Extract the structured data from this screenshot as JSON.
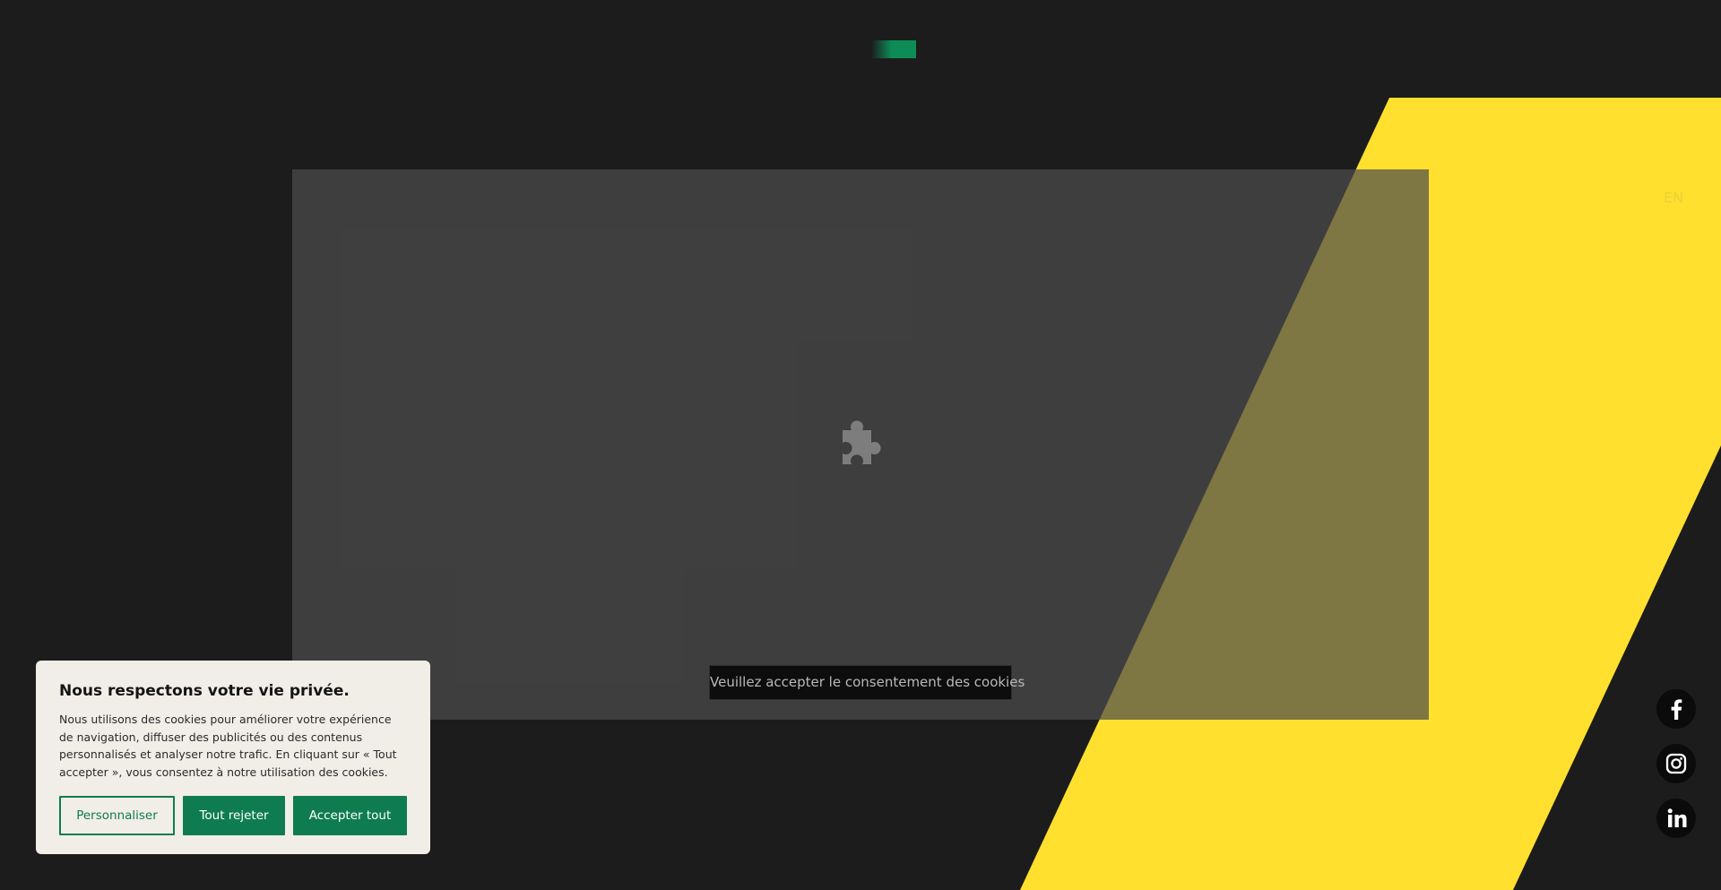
{
  "page": {
    "language_switch": "EN"
  },
  "colors": {
    "background": "#1c1c1c",
    "accent_yellow": "#ffe02e",
    "brand_green": "#0e7c4f",
    "banner_background": "#f1ede7"
  },
  "embed": {
    "icon": "puzzle-piece-icon",
    "consent_notice": "Veuillez accepter le consentement des cookies"
  },
  "social": [
    {
      "name": "Facebook",
      "icon": "facebook-icon"
    },
    {
      "name": "Instagram",
      "icon": "instagram-icon"
    },
    {
      "name": "LinkedIn",
      "icon": "linkedin-icon"
    }
  ],
  "cookie_banner": {
    "title": "Nous respectons votre vie privée.",
    "text": "Nous utilisons des cookies pour améliorer votre expérience de navigation, diffuser des publicités ou des contenus personnalisés et analyser notre trafic. En cliquant sur « Tout accepter », vous consentez à notre utilisation des cookies.",
    "buttons": {
      "customize": "Personnaliser",
      "reject_all": "Tout rejeter",
      "accept_all": "Accepter tout"
    }
  }
}
